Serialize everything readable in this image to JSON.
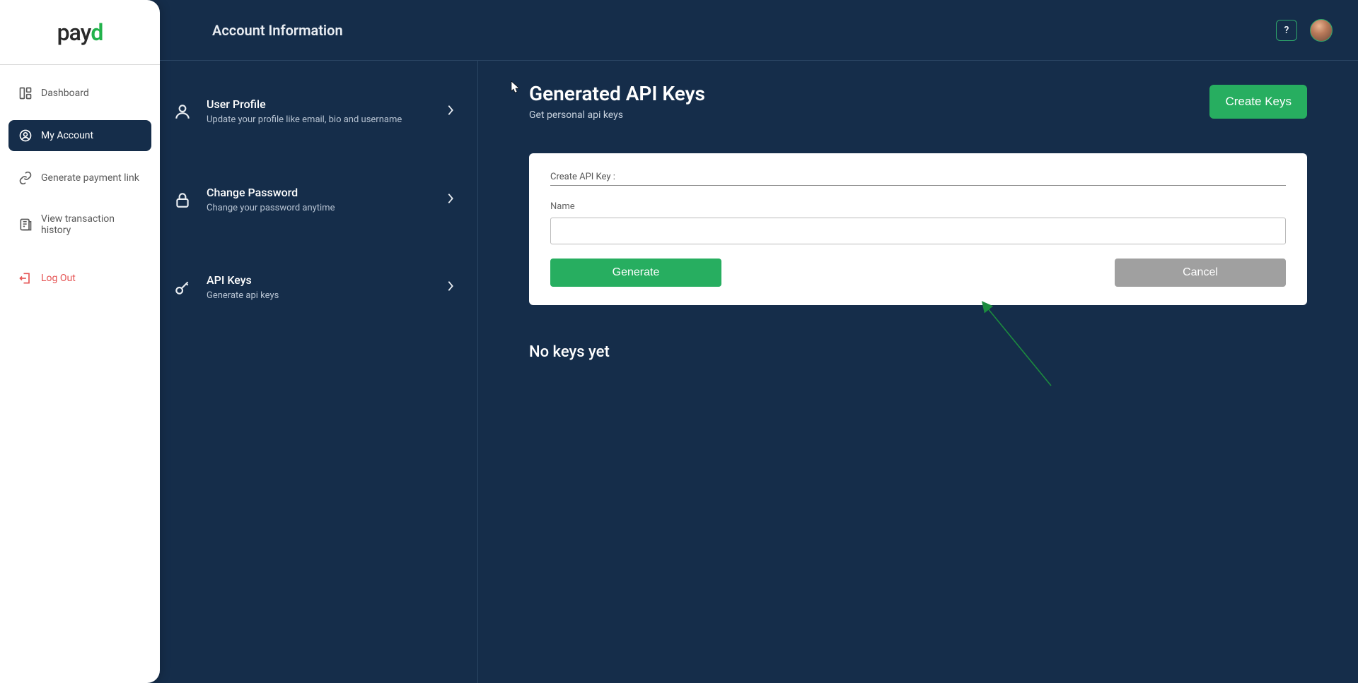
{
  "brand": {
    "prefix": "pay",
    "accent": "d"
  },
  "sidebar": {
    "items": [
      {
        "label": "Dashboard"
      },
      {
        "label": "My Account"
      },
      {
        "label": "Generate payment link"
      },
      {
        "label": "View transaction history"
      },
      {
        "label": "Log Out"
      }
    ]
  },
  "topbar": {
    "title": "Account Information",
    "helpGlyph": "?"
  },
  "settings": {
    "items": [
      {
        "title": "User Profile",
        "desc": "Update your profile like email, bio and username"
      },
      {
        "title": "Change Password",
        "desc": "Change your password anytime"
      },
      {
        "title": "API Keys",
        "desc": "Generate api keys"
      }
    ]
  },
  "panel": {
    "title": "Generated API Keys",
    "subtitle": "Get personal api keys",
    "createBtn": "Create Keys"
  },
  "form": {
    "header": "Create API Key :",
    "nameLabel": "Name",
    "nameValue": "",
    "generate": "Generate",
    "cancel": "Cancel"
  },
  "empty": "No keys yet"
}
